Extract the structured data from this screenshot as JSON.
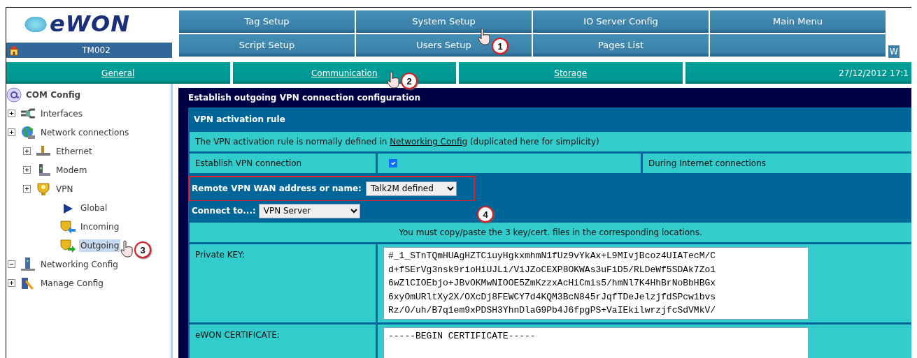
{
  "logo": {
    "text": "eWON"
  },
  "device": {
    "name": "TM002"
  },
  "main_menu": [
    {
      "kind": "item",
      "label": "Tag Setup"
    },
    {
      "kind": "item",
      "label": "System Setup"
    },
    {
      "kind": "item",
      "label": "IO Server Config"
    },
    {
      "kind": "item",
      "label": "Main Menu"
    },
    {
      "kind": "item",
      "label": "Script Setup"
    },
    {
      "kind": "item",
      "label": "Users Setup"
    },
    {
      "kind": "item",
      "label": "Pages List"
    },
    {
      "kind": "blank"
    }
  ],
  "corner_text": "W",
  "sub_tabs": [
    {
      "label": "General",
      "kind": "link"
    },
    {
      "label": "Communication",
      "kind": "link"
    },
    {
      "label": "Storage",
      "kind": "link"
    },
    {
      "label": "27/12/2012 17:1",
      "kind": "date"
    }
  ],
  "sidebar": {
    "title": "COM Config",
    "tree": [
      {
        "label": "Interfaces",
        "kind": "interfaces",
        "expanded": false,
        "selected": false
      },
      {
        "label": "Network connections",
        "kind": "globe",
        "expanded": false,
        "selected": false,
        "children": [
          {
            "label": "Ethernet",
            "kind": "ethernet",
            "expanded": false,
            "selected": false
          },
          {
            "label": "Modem",
            "kind": "modem",
            "expanded": false,
            "selected": false
          },
          {
            "label": "VPN",
            "kind": "shield",
            "expanded": false,
            "selected": false,
            "children": [
              {
                "label": "Global",
                "kind": "arrow",
                "selected": false
              },
              {
                "label": "Incoming",
                "kind": "shield-in",
                "selected": false
              },
              {
                "label": "Outgoing",
                "kind": "shield-out",
                "selected": true
              }
            ]
          }
        ]
      },
      {
        "label": "Networking Config",
        "kind": "server",
        "expanded": true,
        "selected": false
      },
      {
        "label": "Manage Config",
        "kind": "manage",
        "expanded": false,
        "selected": false
      }
    ]
  },
  "panel": {
    "title": "Establish outgoing VPN connection configuration",
    "section": "VPN activation rule",
    "note": {
      "before": "The VPN activation rule is normally defined in",
      "link": "Networking Config",
      "after": "(duplicated here for simplicity)"
    },
    "establish": {
      "label": "Establish VPN connection",
      "checked": true,
      "mode": "During Internet connections"
    },
    "remote": {
      "label": "Remote VPN WAN address or name:",
      "value": "Talk2M defined"
    },
    "connect": {
      "label": "Connect to...:",
      "value": "VPN Server"
    },
    "instruction": "You must copy/paste the 3 key/cert. files in the corresponding locations.",
    "fields": [
      {
        "label": "Private KEY:",
        "lines": [
          "#_1_STnTQmHUAgHZTCiuyHgkxmhmN1fUz9vYkAx+L9MIvjBcoz4UIATecM/C",
          "d+fSErVg3nsk9rioHiUJLi/ViJZoCEXP8OKWAs3uFiD5/RLDeWf5SDAk7Zo1",
          "6wZlCIOEbjo+JBvOKMwNIOOE5ZmKzzxAcHiCmis5/hmNl7K4HhBrNoBbHBGx",
          "6xyOmURltXy2X/OXcDj8FEWCY7d4KQM3BcN845rJqfTDeJelzjfdSPcw1bvs",
          "Rz/O/uh/B7q1em9xPDSH3YhnDlaG9Pb4J6fpgPS+VaIEkilwrzjfcSdVMkV/"
        ]
      },
      {
        "label": "eWON CERTIFICATE:",
        "lines": [
          "-----BEGIN CERTIFICATE-----"
        ]
      }
    ]
  },
  "annotations": [
    {
      "number": "1"
    },
    {
      "number": "2"
    },
    {
      "number": "3"
    },
    {
      "number": "4"
    }
  ]
}
